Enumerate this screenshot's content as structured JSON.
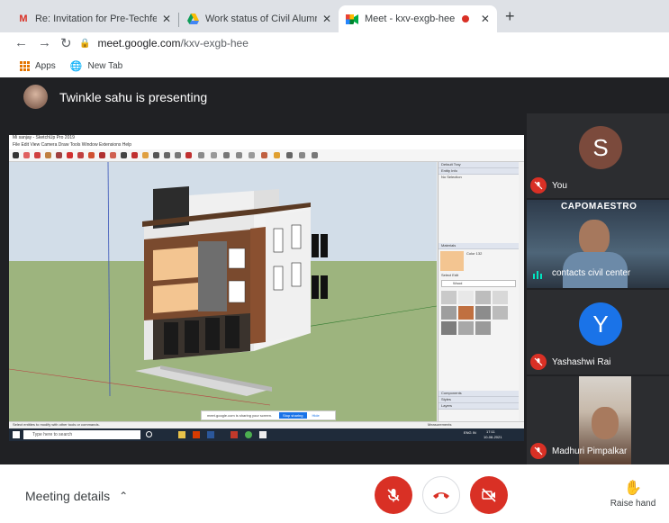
{
  "browser": {
    "tabs": [
      {
        "title": "Re: Invitation for Pre-Techfest W",
        "close": "✕"
      },
      {
        "title": "Work status of Civil Alumni data",
        "close": "✕"
      },
      {
        "title": "Meet - kxv-exgb-hee",
        "close": "✕"
      }
    ],
    "new_tab": "+",
    "url_host": "meet.google.com",
    "url_path": "/kxv-exgb-hee",
    "bookmarks": [
      {
        "label": "Apps"
      },
      {
        "label": "New Tab"
      }
    ]
  },
  "presenter": {
    "text": "Twinkle sahu is presenting"
  },
  "shared_screen": {
    "window_title": "Mi sanjay - SketchUp Pro 2019",
    "menu": "File  Edit  View  Camera  Draw  Tools  Window  Extensions  Help",
    "tray_default": "Default Tray",
    "tray_entity": "Entity Info",
    "tray_entity_value": "No Selection",
    "tray_materials": "Materials",
    "tray_material_name": "Color 132",
    "tray_select": "Select",
    "tray_edit": "Edit",
    "tray_wood": "Wood",
    "tray_components": "Components",
    "tray_styles": "Styles",
    "tray_layers": "Layers",
    "status_text": "Select entities to modify with other tools or commands.",
    "measurements": "Measurements",
    "share_banner_text": "meet.google.com is sharing your screen.",
    "share_stop": "Stop sharing",
    "share_hide": "Hide",
    "taskbar_search": "Type here to search",
    "taskbar_time": "17:11",
    "taskbar_date": "10-08-2021",
    "taskbar_lang": "ENG IN"
  },
  "participants": [
    {
      "name": "You",
      "initial": "S",
      "color": "#7b4a3c"
    },
    {
      "name": "contacts civil center",
      "overlay": "CAPOMAESTRO"
    },
    {
      "name": "Yashashwi Rai",
      "initial": "Y",
      "color": "#1a73e8"
    },
    {
      "name": "Madhuri Pimpalkar"
    }
  ],
  "controls": {
    "meeting_details": "Meeting details",
    "raise_hand": "Raise hand"
  },
  "colors": {
    "mute_red": "#d93025",
    "meet_bg": "#202124"
  }
}
